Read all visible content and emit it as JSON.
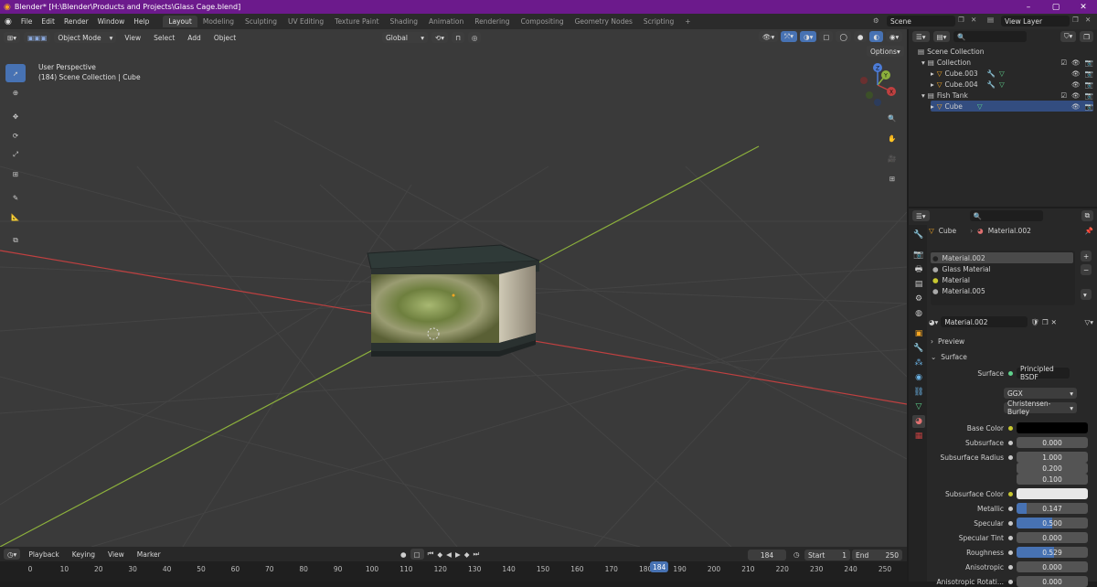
{
  "window": {
    "title": "Blender* [H:\\Blender\\Products and Projects\\Glass Cage.blend]",
    "controls": [
      "–",
      "▢",
      "✕"
    ]
  },
  "menu": {
    "items": [
      "File",
      "Edit",
      "Render",
      "Window",
      "Help"
    ]
  },
  "workspaces": [
    "Layout",
    "Modeling",
    "Sculpting",
    "UV Editing",
    "Texture Paint",
    "Shading",
    "Animation",
    "Rendering",
    "Compositing",
    "Geometry Nodes",
    "Scripting"
  ],
  "workspace_add": "+",
  "scene": {
    "name": "Scene",
    "view_layer": "View Layer"
  },
  "viewport_header": {
    "mode": "Object Mode",
    "menus": [
      "View",
      "Select",
      "Add",
      "Object"
    ],
    "orientation": "Global",
    "options": "Options"
  },
  "viewport": {
    "perspective": "User Perspective",
    "info": "(184) Scene Collection | Cube",
    "gizmo": {
      "x": "X",
      "y": "Y",
      "z": "Z"
    }
  },
  "outliner": {
    "rows": [
      {
        "label": "Scene Collection",
        "indent": 0
      },
      {
        "label": "Collection",
        "indent": 1
      },
      {
        "label": "Cube.003",
        "indent": 2
      },
      {
        "label": "Cube.004",
        "indent": 2
      },
      {
        "label": "Fish Tank",
        "indent": 1
      },
      {
        "label": "Cube",
        "indent": 2
      }
    ]
  },
  "properties": {
    "object": "Cube",
    "material": "Material.002",
    "slots": [
      "Material.002",
      "Glass Material",
      "Material",
      "Material.005"
    ],
    "material_field": "Material.002",
    "panels": {
      "preview": "Preview",
      "surface": "Surface"
    },
    "surface": "Principled BSDF",
    "distribution": "GGX",
    "subsurface_method": "Christensen-Burley",
    "fields": [
      {
        "label": "Base Color",
        "type": "color",
        "color": "#000000"
      },
      {
        "label": "Subsurface",
        "value": "0.000",
        "fill": 0
      },
      {
        "label": "Subsurface Radius",
        "value": "1.000",
        "fill": 0
      },
      {
        "label": "",
        "value": "0.200",
        "fill": 0
      },
      {
        "label": "",
        "value": "0.100",
        "fill": 0
      },
      {
        "label": "Subsurface Color",
        "type": "color",
        "color": "#e8e8e8"
      },
      {
        "label": "Metallic",
        "value": "0.147",
        "fill": 0.147
      },
      {
        "label": "Specular",
        "value": "0.500",
        "fill": 0.5
      },
      {
        "label": "Specular Tint",
        "value": "0.000",
        "fill": 0
      },
      {
        "label": "Roughness",
        "value": "0.529",
        "fill": 0.529
      },
      {
        "label": "Anisotropic",
        "value": "0.000",
        "fill": 0
      },
      {
        "label": "Anisotropic Rotati...",
        "value": "0.000",
        "fill": 0
      }
    ]
  },
  "timeline": {
    "menus": [
      "Playback",
      "Keying",
      "View",
      "Marker"
    ],
    "current_frame": "184",
    "start_label": "Start",
    "start": "1",
    "end_label": "End",
    "end": "250",
    "ticks": [
      "0",
      "10",
      "20",
      "30",
      "40",
      "50",
      "60",
      "70",
      "80",
      "90",
      "100",
      "110",
      "120",
      "130",
      "140",
      "150",
      "160",
      "170",
      "180",
      "190",
      "200",
      "210",
      "220",
      "230",
      "240",
      "250"
    ],
    "playhead": "184"
  },
  "colors": {
    "accent": "#4772b3",
    "title_bar": "#6c1a8c",
    "x_axis": "#c04040",
    "y_axis": "#8cb03c"
  }
}
